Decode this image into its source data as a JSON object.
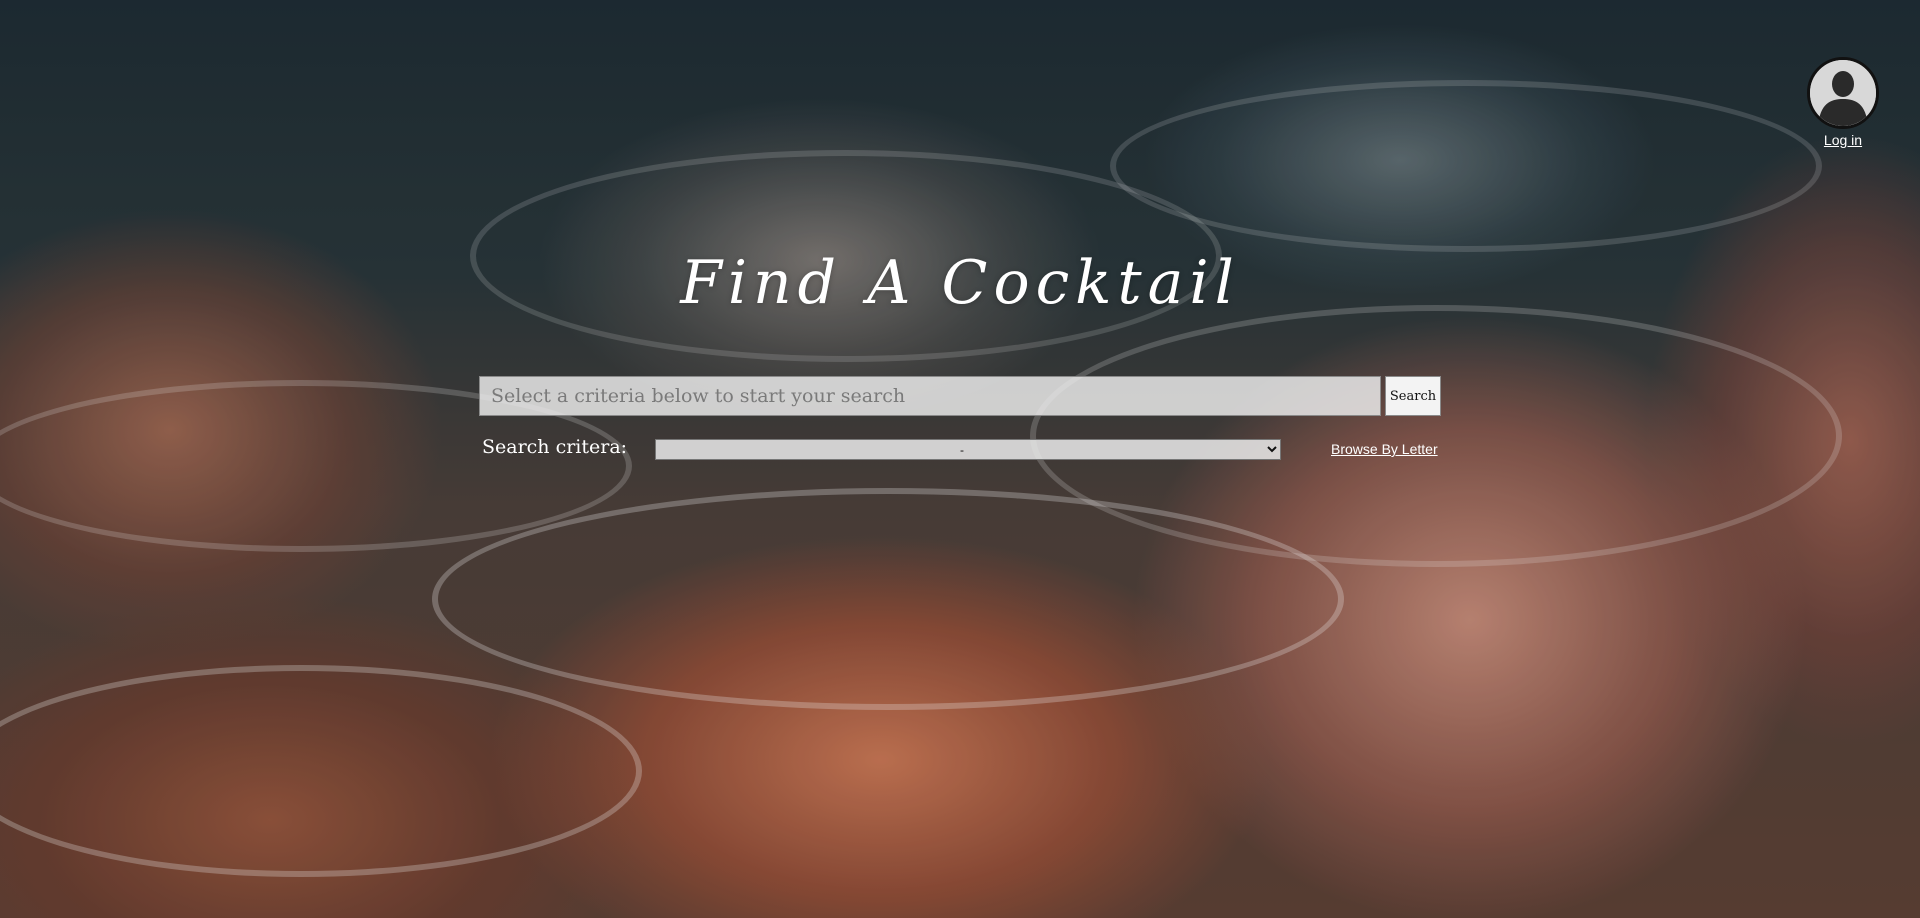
{
  "header": {
    "login_label": "Log in"
  },
  "hero": {
    "title": "Find A Cocktail"
  },
  "search": {
    "placeholder": "Select a criteria below to start your search",
    "value": "",
    "button_label": "Search",
    "criteria_label": "Search critera:",
    "criteria_selected": "-",
    "browse_label": "Browse By Letter"
  },
  "icons": {
    "avatar": "user-silhouette-icon"
  },
  "colors": {
    "text": "#ffffff",
    "input_bg": "#f0f0f0"
  }
}
